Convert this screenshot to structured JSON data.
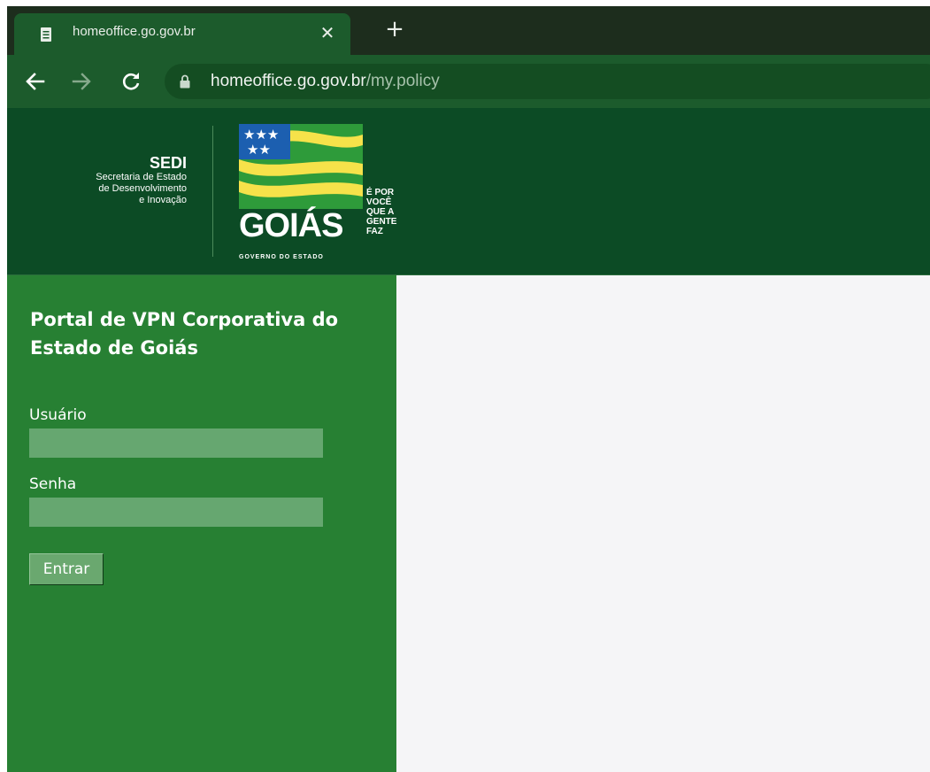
{
  "browser": {
    "tab_title": "homeoffice.go.gov.br",
    "tab_close": "✕",
    "new_tab": "+",
    "url_host": "homeoffice.go.gov.br",
    "url_path": "/my.policy"
  },
  "header": {
    "org_acronym": "SEDI",
    "org_line1": "Secretaria de Estado",
    "org_line2": "de Desenvolvimento",
    "org_line3": "e Inovação",
    "logo_word": "GOIÁS",
    "logo_subtitle": "GOVERNO DO ESTADO",
    "slogan": [
      "É POR",
      "VOCÊ",
      "QUE A",
      "GENTE",
      "FAZ"
    ]
  },
  "login": {
    "title": "Portal de VPN Corporativa do Estado de Goiás",
    "username_label": "Usuário",
    "username_value": "",
    "password_label": "Senha",
    "password_value": "",
    "submit_label": "Entrar"
  },
  "colors": {
    "tab_bar": "#1d2d1d",
    "toolbar": "#1c5b2c",
    "banner": "#0c4b25",
    "sidebar": "#278033",
    "content_bg": "#f5f5f7",
    "logo_blue": "#1c5fb0",
    "logo_yellow": "#f6e24a",
    "logo_green": "#2e9b3a"
  }
}
